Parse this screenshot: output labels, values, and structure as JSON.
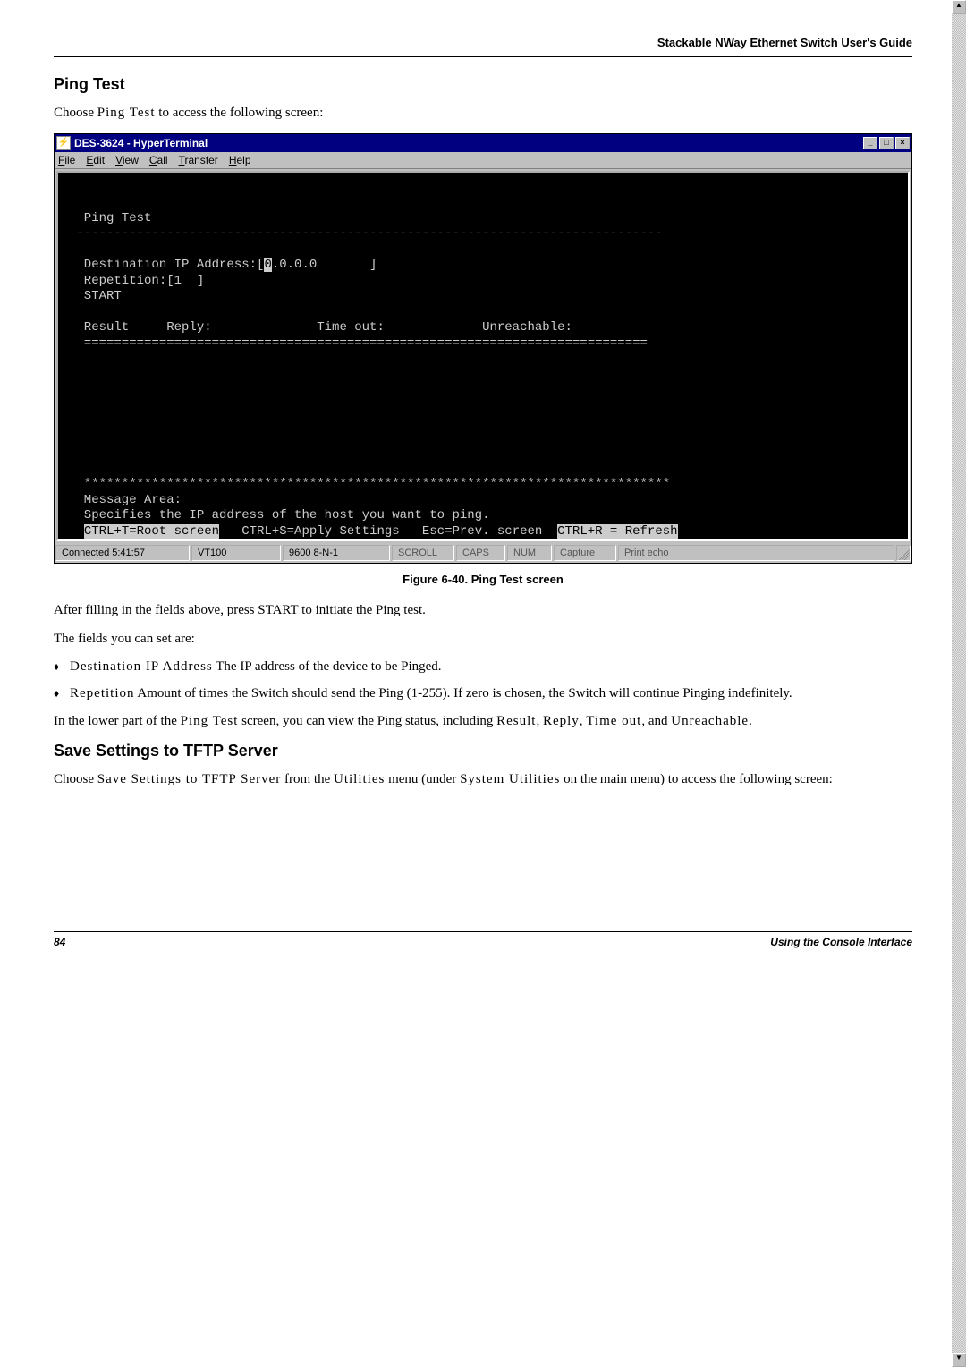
{
  "header": {
    "text": "Stackable NWay Ethernet Switch User's Guide"
  },
  "section1": {
    "heading": "Ping Test",
    "intro_pre": "Choose ",
    "intro_bold": "Ping Test",
    "intro_post": " to access the following screen:"
  },
  "window": {
    "title": "DES-3624 - HyperTerminal",
    "icon_glyph": "⚡",
    "menu": {
      "file": "File",
      "edit": "Edit",
      "view": "View",
      "call": "Call",
      "transfer": "Transfer",
      "help": "Help"
    },
    "terminal": {
      "line1": "  Ping Test",
      "dash": " ------------------------------------------------------------------------------",
      "dest": "  Destination IP Address:[0.0.0.0       ]",
      "dest_label": "  Destination IP Address:[",
      "dest_value_inverse": "0",
      "dest_value_rest": ".0.0.0       ]",
      "rep": "  Repetition:[1  ]",
      "start": "  START",
      "resultline": "  Result     Reply:              Time out:             Unreachable:",
      "eqline": "  ===========================================================================",
      "stars": "  ******************************************************************************",
      "msgarea": "  Message Area:",
      "msgtext": "  Specifies the IP address of the host you want to ping.",
      "hint_pre": "  ",
      "hint_inv1": "CTRL+T=Root screen",
      "hint_mid": "   CTRL+S=Apply Settings   Esc=Prev. screen  ",
      "hint_inv2": "CTRL+R = Refresh"
    },
    "status": {
      "connected": "Connected 5:41:57",
      "vt": "VT100",
      "baud": "9600 8-N-1",
      "scroll": "SCROLL",
      "caps": "CAPS",
      "num": "NUM",
      "capture": "Capture",
      "printecho": "Print echo"
    }
  },
  "figure_caption": "Figure 6-40.  Ping Test screen",
  "after_figure": {
    "p1": "After filling in the fields above, press START to initiate the Ping test.",
    "p2": "The fields you can set are:",
    "b1_term": "Destination IP Address",
    "b1_rest": "  The IP address of the device to be Pinged.",
    "b2_term": "Repetition",
    "b2_rest": "  Amount of times the Switch should send the Ping (1-255). If zero is chosen, the Switch will continue Pinging indefinitely.",
    "p3_pre": "In the lower part of the ",
    "p3_b1": "Ping Test",
    "p3_mid": " screen, you can view the Ping status, including ",
    "p3_b2": "Result",
    "p3_c1": ", ",
    "p3_b3": "Reply",
    "p3_c2": ", ",
    "p3_b4": "Time out",
    "p3_c3": ", and ",
    "p3_b5": "Unreachable",
    "p3_end": "."
  },
  "section2": {
    "heading": "Save Settings to TFTP Server",
    "p_pre": "Choose ",
    "p_b1": "Save Settings to TFTP Server",
    "p_mid1": " from the ",
    "p_b2": "Utilities",
    "p_mid2": " menu (under ",
    "p_b3": "System Utilities",
    "p_mid3": " on the main menu) to access the following screen:"
  },
  "footer": {
    "page": "84",
    "label": "Using the Console Interface"
  }
}
